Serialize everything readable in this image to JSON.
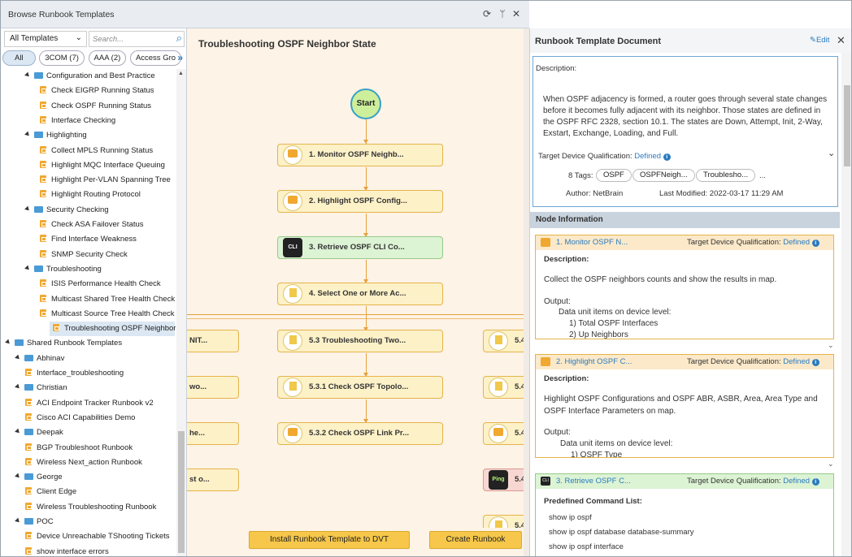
{
  "window": {
    "title": "Browse Runbook Templates"
  },
  "left": {
    "template_select": "All Templates",
    "search_placeholder": "Search...",
    "chips": [
      "All",
      "3COM (7)",
      "AAA (2)",
      "Access Gro"
    ],
    "tree": [
      {
        "type": "folder",
        "label": "Configuration and Best Practice",
        "level": 2
      },
      {
        "type": "item",
        "label": "Check EIGRP Running Status",
        "level": 3
      },
      {
        "type": "item",
        "label": "Check OSPF Running Status",
        "level": 3
      },
      {
        "type": "item",
        "label": "Interface Checking",
        "level": 3
      },
      {
        "type": "folder",
        "label": "Highlighting",
        "level": 2
      },
      {
        "type": "item",
        "label": "Collect MPLS Running Status",
        "level": 3
      },
      {
        "type": "item",
        "label": "Highlight MQC Interface Queuing",
        "level": 3
      },
      {
        "type": "item",
        "label": "Highlight Per-VLAN Spanning Tree",
        "level": 3
      },
      {
        "type": "item",
        "label": "Highlight Routing Protocol",
        "level": 3
      },
      {
        "type": "folder",
        "label": "Security Checking",
        "level": 2
      },
      {
        "type": "item",
        "label": "Check ASA Failover Status",
        "level": 3
      },
      {
        "type": "item",
        "label": "Find Interface Weakness",
        "level": 3
      },
      {
        "type": "item",
        "label": "SNMP Security Check",
        "level": 3
      },
      {
        "type": "folder",
        "label": "Troubleshooting",
        "level": 2
      },
      {
        "type": "item",
        "label": "ISIS Performance Health Check",
        "level": 3
      },
      {
        "type": "item",
        "label": "Multicast Shared Tree Health Check",
        "level": 3
      },
      {
        "type": "item",
        "label": "Multicast Source Tree Health Check",
        "level": 3
      },
      {
        "type": "item",
        "label": "Troubleshooting OSPF Neighbor ...",
        "level": 3,
        "selected": true
      },
      {
        "type": "folder",
        "label": "Shared Runbook Templates",
        "level": 0
      },
      {
        "type": "folder",
        "label": "Abhinav",
        "level": 1
      },
      {
        "type": "item",
        "label": "Interface_troubleshooting",
        "level": 2
      },
      {
        "type": "folder",
        "label": "Christian",
        "level": 1
      },
      {
        "type": "item",
        "label": "ACI Endpoint Tracker Runbook v2",
        "level": 2
      },
      {
        "type": "item",
        "label": "Cisco ACI Capabilities Demo",
        "level": 2
      },
      {
        "type": "folder",
        "label": "Deepak",
        "level": 1
      },
      {
        "type": "item",
        "label": "BGP Troubleshoot Runbook",
        "level": 2
      },
      {
        "type": "item",
        "label": "Wireless Next_action Runbook",
        "level": 2
      },
      {
        "type": "folder",
        "label": "George",
        "level": 1
      },
      {
        "type": "item",
        "label": "Client Edge",
        "level": 2
      },
      {
        "type": "item",
        "label": "Wireless Troubleshooting Runbook",
        "level": 2
      },
      {
        "type": "folder",
        "label": "POC",
        "level": 1
      },
      {
        "type": "item",
        "label": "Device Unreachable TShooting Tickets",
        "level": 2
      },
      {
        "type": "item",
        "label": "show interface errors",
        "level": 2
      }
    ]
  },
  "center": {
    "title": "Troubleshooting OSPF Neighbor State",
    "start_label": "Start",
    "nodes": {
      "n1": "1. Monitor OSPF Neighb...",
      "n2": "2. Highlight OSPF Config...",
      "n3": "3. Retrieve OSPF CLI Co...",
      "n4": "4. Select One or More Ac...",
      "n53": "5.3 Troubleshooting Two...",
      "n531": "5.3.1 Check OSPF Topolo...",
      "n532": "5.3.2 Check OSPF Link Pr...",
      "left1": "NIT...",
      "left2": "wo...",
      "left3": "he...",
      "left4": "st o...",
      "right1": "5.4",
      "right2": "5.4",
      "right3": "5.4",
      "right4": "5.4",
      "right5": "5.4"
    },
    "cli_badge": "CLI",
    "ping_badge": "Ping",
    "install_button": "Install Runbook Template to DVT",
    "create_button": "Create Runbook"
  },
  "right": {
    "title": "Runbook Template Document",
    "edit_label": "Edit",
    "description_label": "Description:",
    "description": "When OSPF adjacency is formed, a router goes through several state changes before it becomes fully adjacent with its neighbor. Those states are defined in the OSPF RFC 2328, section 10.1. The states are Down, Attempt, Init, 2-Way, Exstart, Exchange, Loading, and Full.",
    "target_label": "Target Device Qualification:",
    "target_value": "Defined",
    "tags_label": "8 Tags:",
    "tags": [
      "OSPF",
      "OSPFNeigh...",
      "Troublesho...",
      "..."
    ],
    "author": "Author: NetBrain",
    "last_modified": "Last Modified: 2022-03-17 11:29 AM",
    "node_info_header": "Node Information",
    "cards": [
      {
        "title": "1. Monitor OSPF N...",
        "qual_label": "Target Device Qualification:",
        "qual_value": "Defined",
        "desc_label": "Description:",
        "desc": "Collect the OSPF neighbors counts and show the results in map.",
        "output_label": "Output:",
        "output_line": "Data unit items on device level:",
        "items": [
          "1) Total OSPF Interfaces",
          "2) Up Neighbors"
        ]
      },
      {
        "title": "2. Highlight OSPF C...",
        "qual_label": "Target Device Qualification:",
        "qual_value": "Defined",
        "desc_label": "Description:",
        "desc": "Highlight OSPF Configurations and OSPF ABR, ASBR, Area, Area Type and OSPF Interface Parameters on map.",
        "output_label": "Output:",
        "output_line": "Data unit items on device level:",
        "items": [
          "1) OSPF Type"
        ]
      },
      {
        "title": "3. Retrieve OSPF C...",
        "qual_label": "Target Device Qualification:",
        "qual_value": "Defined",
        "cmd_label": "Predefined Command List:",
        "commands": [
          "show ip ospf",
          "show ip ospf database database-summary",
          "show ip ospf interface"
        ]
      }
    ]
  }
}
